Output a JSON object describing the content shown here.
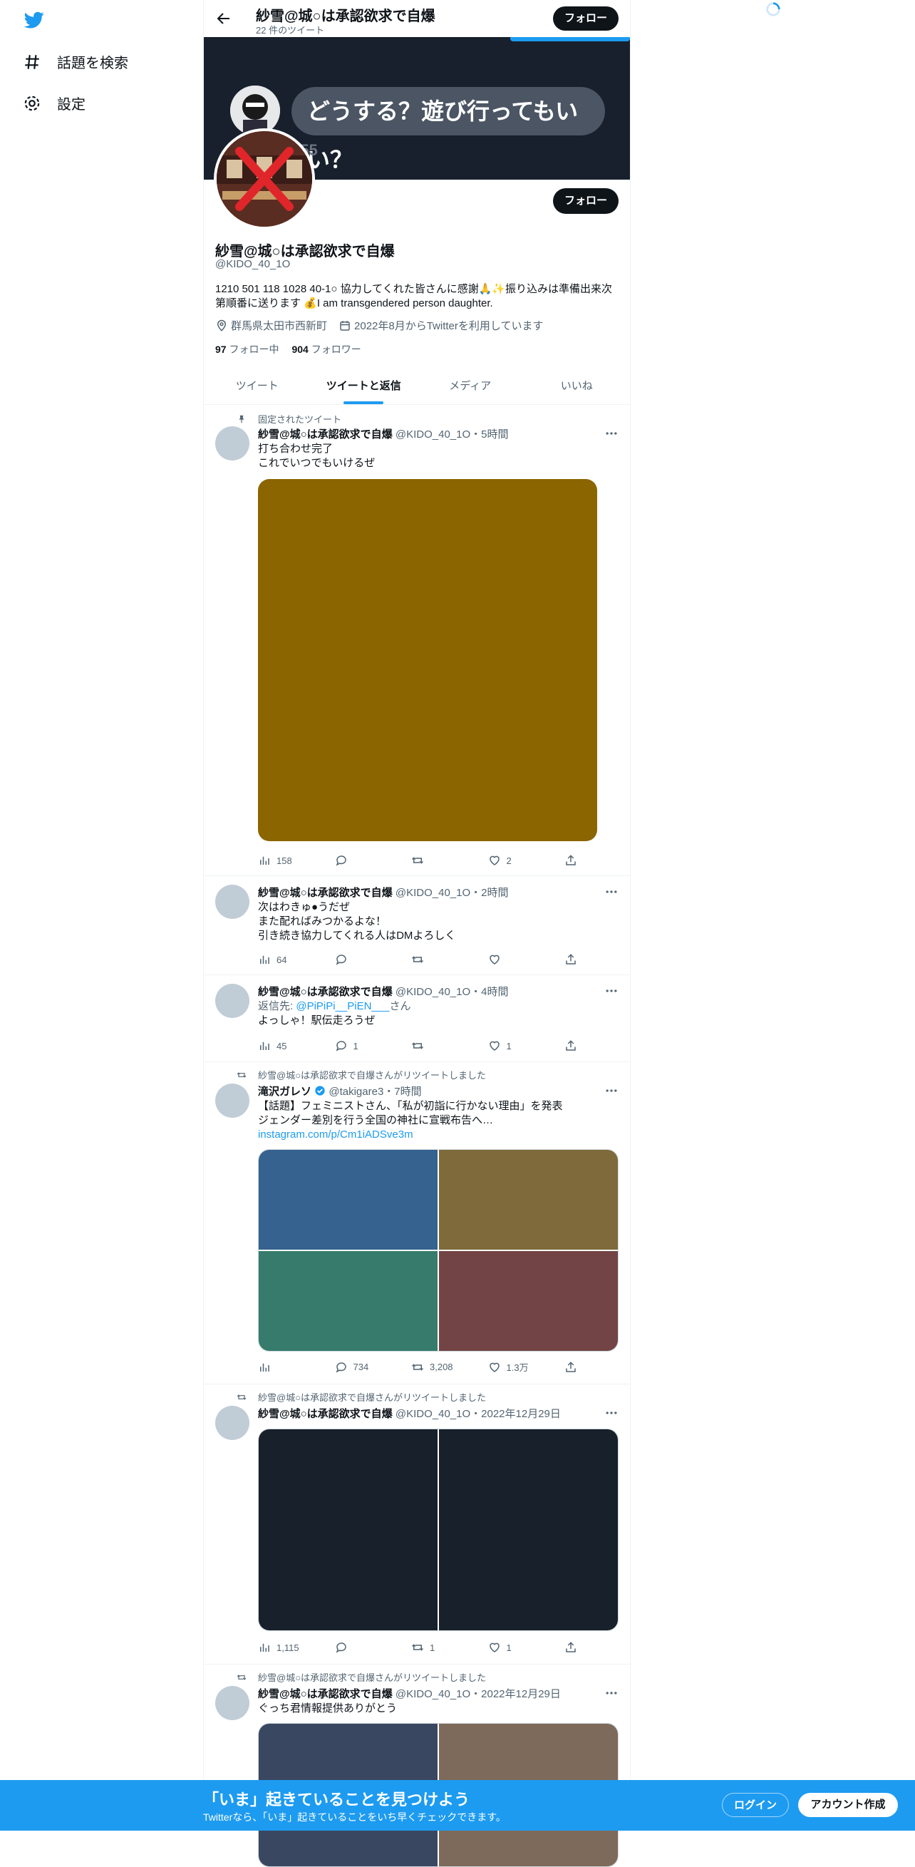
{
  "nav": {
    "explore_label": "話題を検索",
    "settings_label": "設定"
  },
  "header": {
    "title": "紗雪@城○は承認欲求で自爆",
    "tweet_count": "22 件のツイート",
    "follow_label": "フォロー"
  },
  "banner": {
    "bubble_text": "どうする？遊び行ってもいい？",
    "time_fragment": ":55"
  },
  "profile": {
    "display_name": "紗雪@城○は承認欲求で自爆",
    "handle": "@KIDO_40_1O",
    "follow_label": "フォロー",
    "bio_line1": "1210 501 118 1028 40-1○ 協力してくれた皆さんに感謝🙏✨振り込みは準備出来次",
    "bio_line2": "第順番に送ります 💰I am transgendered person daughter.",
    "location": "群馬県太田市西新町",
    "joined": "2022年8月からTwitterを利用しています",
    "following_count": "97",
    "following_label": "フォロー中",
    "followers_count": "904",
    "followers_label": "フォロワー"
  },
  "tabs": [
    {
      "label": "ツイート"
    },
    {
      "label": "ツイートと返信"
    },
    {
      "label": "メディア"
    },
    {
      "label": "いいね"
    }
  ],
  "tweets": [
    {
      "context": "固定されたツイート",
      "name": "紗雪@城○は承認欲求で自爆",
      "meta": " @KIDO_40_1O・5時間",
      "line1": "打ち合わせ完了",
      "line2": "これでいつでもいけるぜ",
      "media_color": "#8b6500",
      "views": "158",
      "replies": "",
      "retweets": "",
      "likes": "2"
    },
    {
      "name": "紗雪@城○は承認欲求で自爆",
      "meta": " @KIDO_40_1O・2時間",
      "line1": "次はわきゅ●うだぜ",
      "line2": "また配ればみつかるよな！",
      "line3": "引き続き協力してくれる人はDMよろしく",
      "views": "64",
      "replies": "",
      "retweets": "",
      "likes": ""
    },
    {
      "name": "紗雪@城○は承認欲求で自爆",
      "meta": " @KIDO_40_1O・4時間",
      "reply_prefix": "返信先: ",
      "reply_to": "@PiPiPi__PiEN___",
      "reply_suffix": "さん",
      "line1": "よっしゃ！駅伝走ろうぜ",
      "views": "45",
      "replies": "1",
      "retweets": "",
      "likes": "1"
    },
    {
      "context": "紗雪@城○は承認欲求で自爆さんがリツイートしました",
      "name": "滝沢ガレソ",
      "meta": " @takigare3・7時間",
      "line1": "【話題】フェミニストさん、「私が初詣に行かない理由」を発表",
      "line2": "ジェンダー差別を行う全国の神社に宣戦布告へ…",
      "link": "instagram.com/p/Cm1iADSve3m",
      "media_colors": [
        "#35628f",
        "#7e6a3a",
        "#367b6c",
        "#734445"
      ],
      "views": "",
      "replies": "734",
      "retweets": "3,208",
      "likes": "1.3万"
    },
    {
      "context": "紗雪@城○は承認欲求で自爆さんがリツイートしました",
      "name": "紗雪@城○は承認欲求で自爆",
      "meta": " @KIDO_40_1O・2022年12月29日",
      "media_colors": [
        "#17202b",
        "#17202b"
      ],
      "views": "1,115",
      "replies": "",
      "retweets": "1",
      "likes": "1"
    },
    {
      "context": "紗雪@城○は承認欲求で自爆さんがリツイートしました",
      "name": "紗雪@城○は承認欲求で自爆",
      "meta": " @KIDO_40_1O・2022年12月29日",
      "line1": "ぐっち君情報提供ありがとう",
      "media_colors": [
        "#394761",
        "#7e6a5a"
      ]
    }
  ],
  "bottom_bar": {
    "title": "「いま」起きていることを見つけよう",
    "subtitle": "Twitterなら、「いま」起きていることをいち早くチェックできます。",
    "login_label": "ログイン",
    "signup_label": "アカウント作成"
  },
  "colors": {
    "accent": "#1d9bf0",
    "text": "#0f1419",
    "muted": "#536471"
  }
}
